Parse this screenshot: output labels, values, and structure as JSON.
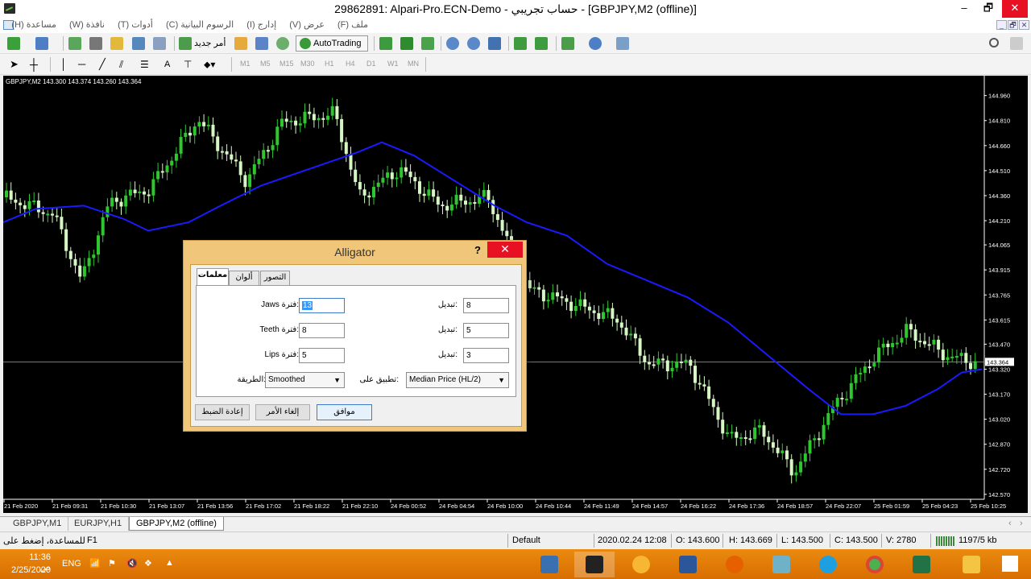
{
  "window": {
    "title": "29862891: Alpari-Pro.ECN-Demo - حساب تجريبي - [GBPJPY,M2 (offline)]",
    "minimize": "–",
    "maximize": "🗗",
    "close": "✕"
  },
  "menu": {
    "items": [
      "ملف (F)",
      "عرض (V)",
      "إدارج (I)",
      "الرسوم البيانية (C)",
      "أدوات (T)",
      "نافذة (W)",
      "مساعدة (H)"
    ],
    "child_controls": [
      "_",
      "🗗",
      "✕"
    ]
  },
  "toolbar": {
    "new_order_label": "أمر جديد",
    "autotrading_label": "AutoTrading",
    "text_tool_label": "A",
    "timeframes": [
      "M1",
      "M5",
      "M15",
      "M30",
      "H1",
      "H4",
      "D1",
      "W1",
      "MN"
    ]
  },
  "chart": {
    "symbol_info": "GBPJPY,M2  143.300 143.374 143.260 143.364",
    "current_price": "143.364",
    "price_labels": [
      "144.960",
      "144.810",
      "144.660",
      "144.510",
      "144.360",
      "144.210",
      "144.065",
      "143.915",
      "143.765",
      "143.615",
      "143.470",
      "143.320",
      "143.170",
      "143.020",
      "142.870",
      "142.720",
      "142.570"
    ],
    "time_labels": [
      "21 Feb 2020",
      "21 Feb 09:31",
      "21 Feb 10:30",
      "21 Feb 13:07",
      "21 Feb 13:56",
      "21 Feb 17:02",
      "21 Feb 18:22",
      "21 Feb 22:10",
      "24 Feb 00:52",
      "24 Feb 04:54",
      "24 Feb 10:00",
      "24 Feb 10:44",
      "24 Feb 11:49",
      "24 Feb 14:57",
      "24 Feb 16:22",
      "24 Feb 17:36",
      "24 Feb 18:57",
      "24 Feb 22:07",
      "25 Feb 01:59",
      "25 Feb 04:23",
      "25 Feb 10:25"
    ],
    "colors": {
      "bull": "#2ec82e",
      "bear": "#d6f7c4",
      "line": "#1a1aff",
      "background": "#000000"
    }
  },
  "dialog": {
    "title": "Alligator",
    "help": "?",
    "close": "✕",
    "tabs": [
      "معلمات",
      "ألوان",
      "التصور"
    ],
    "fields": {
      "jaws_label": "Jaws فترة:",
      "jaws_value": "13",
      "teeth_label": "Teeth فترة:",
      "teeth_value": "8",
      "lips_label": "Lips فترة:",
      "lips_value": "5",
      "shift_label": "تبديل:",
      "jaws_shift": "8",
      "teeth_shift": "5",
      "lips_shift": "3",
      "method_label": "الطريقة:",
      "method_value": "Smoothed",
      "apply_label": "تطبيق على:",
      "apply_value": "Median Price (HL/2)"
    },
    "buttons": {
      "reset": "إعادة الضبط",
      "cancel": "إلغاء الأمر",
      "ok": "موافق"
    }
  },
  "tabs": [
    "GBPJPY,M1",
    "EURJPY,H1",
    "GBPJPY,M2 (offline)"
  ],
  "status": {
    "help": "للمساعدة، إضغط على",
    "help_key": "F1",
    "profile": "Default",
    "datetime": "2020.02.24 12:08",
    "open": "O: 143.600",
    "high": "H: 143.669",
    "low": "L: 143.500",
    "close": "C: 143.500",
    "volume": "V: 2780",
    "traffic": "1197/5 kb"
  },
  "taskbar": {
    "time": "11:36 ص",
    "date": "2/25/2020",
    "lang": "ENG"
  }
}
